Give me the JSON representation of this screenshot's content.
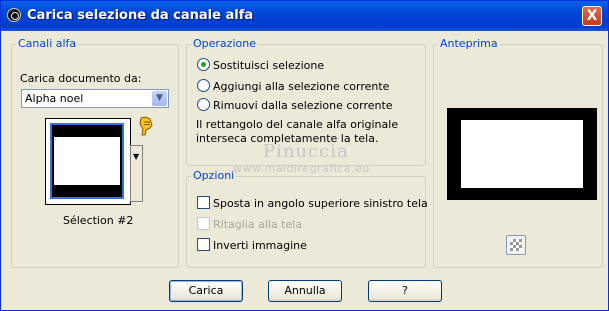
{
  "window": {
    "title": "Carica selezione da canale alfa",
    "close_glyph": "X"
  },
  "canali_alfa": {
    "legend": "Canali alfa",
    "doc_label": "Carica documento da:",
    "doc_value": "Alpha noel",
    "dropdown_glyph": "▼",
    "selection_name": "Sélection #2"
  },
  "operazione": {
    "legend": "Operazione",
    "options": [
      "Sostituisci selezione",
      "Aggiungi alla selezione corrente",
      "Rimuovi dalla selezione corrente"
    ],
    "selected": "Sostituisci selezione",
    "info_line1": "Il rettangolo del canale alfa originale",
    "info_line2": "interseca completamente la tela."
  },
  "opzioni": {
    "legend": "Opzioni",
    "items": [
      "Sposta in angolo superiore sinistro tela",
      "Ritaglia alla tela",
      "Inverti immagine"
    ]
  },
  "anteprima": {
    "legend": "Anteprima"
  },
  "watermark": {
    "line1": "Pinuccia",
    "line2": "www.maidiregrafica.eu"
  },
  "buttons": {
    "ok": "Carica",
    "cancel": "Annulla",
    "help": "?"
  },
  "icons": {
    "app": "app-icon",
    "close": "close-icon",
    "dropdown": "chevron-down-icon",
    "hand": "hand-pointer-icon",
    "checker": "transparency-checkerboard-icon"
  },
  "colors": {
    "titlebar": "#0046d5",
    "legend": "#0046d5",
    "dialog_bg": "#ece9d8"
  }
}
